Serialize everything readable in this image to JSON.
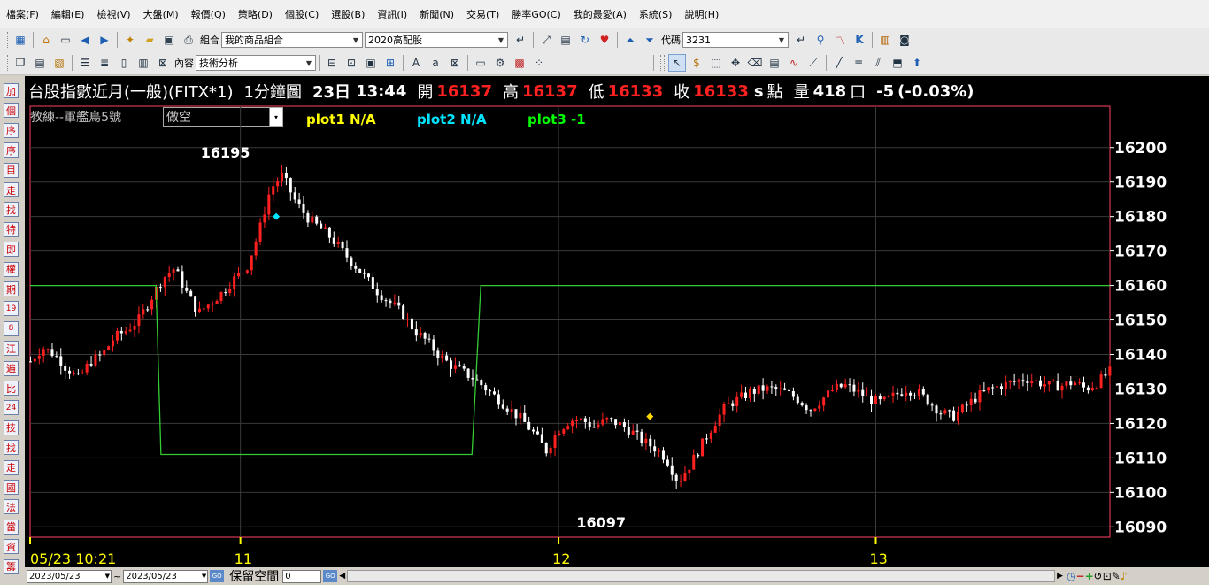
{
  "menu": [
    "檔案(F)",
    "編輯(E)",
    "檢視(V)",
    "大盤(M)",
    "報價(Q)",
    "策略(D)",
    "個股(C)",
    "選股(B)",
    "資訊(I)",
    "新聞(N)",
    "交易(T)",
    "勝率GO(C)",
    "我的最愛(A)",
    "系統(S)",
    "說明(H)"
  ],
  "toolbar1": {
    "group_label": "組合",
    "group_value": "我的商品組合",
    "portfolio_value": "2020高配股",
    "code_label": "代碼",
    "code_value": "3231"
  },
  "toolbar2": {
    "content_label": "內容",
    "content_value": "技術分析"
  },
  "sidebar_items": [
    "加",
    "個",
    "序",
    "序",
    "目",
    "走",
    "找",
    "特",
    "即",
    "權",
    "期",
    "19",
    "8",
    "江",
    "遍",
    "比",
    "24",
    "技",
    "找",
    "走",
    "國",
    "法",
    "當",
    "資",
    "籌"
  ],
  "header": {
    "name": "台股指數近月(一般)(FITX*1)",
    "period": "1分鐘圖",
    "day": "23日",
    "time": "13:44",
    "open_label": "開",
    "open": "16137",
    "high_label": "高",
    "high": "16137",
    "low_label": "低",
    "low": "16133",
    "close_label": "收",
    "close": "16133",
    "s_label": "s",
    "points_label": "點",
    "vol_label": "量",
    "volume": "418",
    "unit": "口",
    "change": "-5",
    "change_pct": "(-0.03%)"
  },
  "strategy": {
    "name": "教練--軍艦鳥5號",
    "position": "做空",
    "plot1": "plot1 N/A",
    "plot2": "plot2 N/A",
    "plot3": "plot3 -1"
  },
  "colors": {
    "up": "#ff2020",
    "down": "#ffffff",
    "plot1": "#ffff00",
    "plot2": "#00e5ff",
    "plot3": "#00ff00",
    "line": "#33cc33",
    "border": "#ff4060"
  },
  "chart_data": {
    "type": "candlestick",
    "y_ticks": [
      16200,
      16190,
      16180,
      16170,
      16160,
      16150,
      16140,
      16130,
      16120,
      16110,
      16100,
      16090
    ],
    "ylim": [
      16087,
      16212
    ],
    "x_labels": [
      "05/23 10:21",
      "11",
      "12",
      "13"
    ],
    "annotations": {
      "high": "16195",
      "low": "16097"
    },
    "close_path": [
      16138,
      16142,
      16140,
      16136,
      16133,
      16138,
      16140,
      16145,
      16147,
      16150,
      16156,
      16162,
      16165,
      16158,
      16152,
      16155,
      16158,
      16162,
      16165,
      16175,
      16188,
      16192,
      16185,
      16180,
      16177,
      16174,
      16170,
      16166,
      16162,
      16158,
      16155,
      16152,
      16147,
      16144,
      16140,
      16137,
      16135,
      16133,
      16130,
      16127,
      16124,
      16121,
      16117,
      16112,
      16118,
      16121,
      16121,
      16119,
      16121,
      16120,
      16118,
      16115,
      16113,
      16110,
      16103,
      16108,
      16114,
      16120,
      16125,
      16127,
      16129,
      16130,
      16130,
      16129,
      16127,
      16124,
      16127,
      16130,
      16131,
      16129,
      16127,
      16126,
      16128,
      16130,
      16129,
      16126,
      16123,
      16122,
      16125,
      16128,
      16130,
      16131,
      16132,
      16133,
      16132,
      16131,
      16131,
      16132,
      16130,
      16132,
      16135
    ],
    "plot3_steps": [
      [
        0,
        16160
      ],
      [
        0.1166,
        16160
      ],
      [
        0.1212,
        16111
      ],
      [
        0.4092,
        16111
      ],
      [
        0.4174,
        16160
      ],
      [
        1,
        16160
      ]
    ],
    "markers": [
      {
        "x": 0.228,
        "y": 16180,
        "color": "#00e5ff"
      },
      {
        "x": 0.574,
        "y": 16122,
        "color": "#ffd700"
      }
    ]
  },
  "status": {
    "date_from": "2023/05/23",
    "date_to": "2023/05/23",
    "tilde": "~",
    "go": "GO",
    "reserve_label": "保留空間",
    "reserve_value": "0"
  }
}
